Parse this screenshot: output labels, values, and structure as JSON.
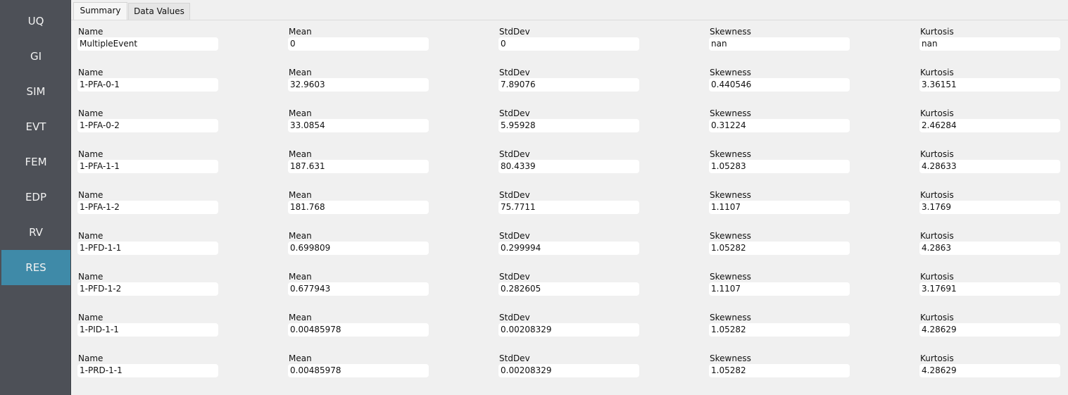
{
  "sidebar": {
    "items": [
      {
        "label": "UQ",
        "active": false
      },
      {
        "label": "GI",
        "active": false
      },
      {
        "label": "SIM",
        "active": false
      },
      {
        "label": "EVT",
        "active": false
      },
      {
        "label": "FEM",
        "active": false
      },
      {
        "label": "EDP",
        "active": false
      },
      {
        "label": "RV",
        "active": false
      },
      {
        "label": "RES",
        "active": true
      }
    ],
    "active_color": "#3f8aa8",
    "background_color": "#4d5057"
  },
  "tabs": [
    {
      "label": "Summary",
      "active": true
    },
    {
      "label": "Data Values",
      "active": false
    }
  ],
  "columns": [
    "Name",
    "Mean",
    "StdDev",
    "Skewness",
    "Kurtosis"
  ],
  "rows": [
    {
      "name": "MultipleEvent",
      "mean": "0",
      "stddev": "0",
      "skewness": "nan",
      "kurtosis": "nan"
    },
    {
      "name": "1-PFA-0-1",
      "mean": "32.9603",
      "stddev": "7.89076",
      "skewness": "0.440546",
      "kurtosis": "3.36151"
    },
    {
      "name": "1-PFA-0-2",
      "mean": "33.0854",
      "stddev": "5.95928",
      "skewness": "0.31224",
      "kurtosis": "2.46284"
    },
    {
      "name": "1-PFA-1-1",
      "mean": "187.631",
      "stddev": "80.4339",
      "skewness": "1.05283",
      "kurtosis": "4.28633"
    },
    {
      "name": "1-PFA-1-2",
      "mean": "181.768",
      "stddev": "75.7711",
      "skewness": "1.1107",
      "kurtosis": "3.1769"
    },
    {
      "name": "1-PFD-1-1",
      "mean": "0.699809",
      "stddev": "0.299994",
      "skewness": "1.05282",
      "kurtosis": "4.2863"
    },
    {
      "name": "1-PFD-1-2",
      "mean": "0.677943",
      "stddev": "0.282605",
      "skewness": "1.1107",
      "kurtosis": "3.17691"
    },
    {
      "name": "1-PID-1-1",
      "mean": "0.00485978",
      "stddev": "0.00208329",
      "skewness": "1.05282",
      "kurtosis": "4.28629"
    },
    {
      "name": "1-PRD-1-1",
      "mean": "0.00485978",
      "stddev": "0.00208329",
      "skewness": "1.05282",
      "kurtosis": "4.28629"
    }
  ]
}
